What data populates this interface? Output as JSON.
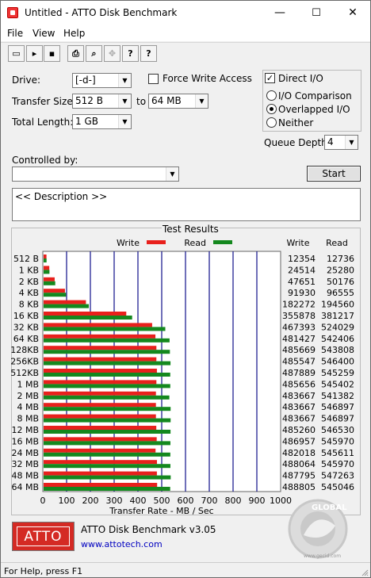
{
  "window": {
    "title": "Untitled - ATTO Disk Benchmark",
    "min": "—",
    "max": "☐",
    "close": "✕"
  },
  "menu": [
    "File",
    "View",
    "Help"
  ],
  "toolbar": {
    "new": "▭",
    "open": "▸",
    "save": "▪",
    "print": "⎙",
    "preview": "⌕",
    "move": "✥",
    "help": "?",
    "context_help": "?"
  },
  "form": {
    "drive_label": "Drive:",
    "drive_value": "[-d-]",
    "transfer_size_label": "Transfer Size:",
    "transfer_size_from": "512 B",
    "to_label": "to",
    "transfer_size_to": "64 MB",
    "total_length_label": "Total Length:",
    "total_length_value": "1 GB",
    "force_write_label": "Force Write Access",
    "force_write_checked": false,
    "direct_io_label": "Direct I/O",
    "direct_io_checked": true,
    "io_comparison_label": "I/O Comparison",
    "overlapped_io_label": "Overlapped I/O",
    "neither_label": "Neither",
    "selected_io_mode": "Overlapped I/O",
    "queue_depth_label": "Queue Depth:",
    "queue_depth_value": "4",
    "controlled_by_label": "Controlled by:",
    "controlled_by_value": "",
    "start_label": "Start",
    "description": "<< Description >>",
    "check_mark": "✓",
    "dropdown_arrow": "▼"
  },
  "results": {
    "title": "Test Results",
    "legend_write": "Write",
    "legend_read": "Read",
    "col_write": "Write",
    "col_read": "Read",
    "rows": [
      {
        "size": "512 B",
        "write": "12354",
        "read": "12736"
      },
      {
        "size": "1 KB",
        "write": "24514",
        "read": "25280"
      },
      {
        "size": "2 KB",
        "write": "47651",
        "read": "50176"
      },
      {
        "size": "4 KB",
        "write": "91930",
        "read": "96555"
      },
      {
        "size": "8 KB",
        "write": "182272",
        "read": "194560"
      },
      {
        "size": "16 KB",
        "write": "355878",
        "read": "381217"
      },
      {
        "size": "32 KB",
        "write": "467393",
        "read": "524029"
      },
      {
        "size": "64 KB",
        "write": "481427",
        "read": "542406"
      },
      {
        "size": "128KB",
        "write": "485669",
        "read": "543808"
      },
      {
        "size": "256KB",
        "write": "485547",
        "read": "546400"
      },
      {
        "size": "512KB",
        "write": "487889",
        "read": "545259"
      },
      {
        "size": "1 MB",
        "write": "485656",
        "read": "545402"
      },
      {
        "size": "2 MB",
        "write": "483667",
        "read": "541382"
      },
      {
        "size": "4 MB",
        "write": "483667",
        "read": "546897"
      },
      {
        "size": "8 MB",
        "write": "483667",
        "read": "546897"
      },
      {
        "size": "12 MB",
        "write": "485260",
        "read": "546530"
      },
      {
        "size": "16 MB",
        "write": "486957",
        "read": "545970"
      },
      {
        "size": "24 MB",
        "write": "482018",
        "read": "545611"
      },
      {
        "size": "32 MB",
        "write": "488064",
        "read": "545970"
      },
      {
        "size": "48 MB",
        "write": "487795",
        "read": "547263"
      },
      {
        "size": "64 MB",
        "write": "488805",
        "read": "545046"
      }
    ],
    "x_ticks": [
      "0",
      "100",
      "200",
      "300",
      "400",
      "500",
      "600",
      "700",
      "800",
      "900",
      "1000"
    ],
    "x_axis_label": "Transfer Rate - MB / Sec"
  },
  "chart_data": {
    "type": "bar",
    "orientation": "horizontal",
    "categories": [
      "512 B",
      "1 KB",
      "2 KB",
      "4 KB",
      "8 KB",
      "16 KB",
      "32 KB",
      "64 KB",
      "128KB",
      "256KB",
      "512KB",
      "1 MB",
      "2 MB",
      "4 MB",
      "8 MB",
      "12 MB",
      "16 MB",
      "24 MB",
      "32 MB",
      "48 MB",
      "64 MB"
    ],
    "series": [
      {
        "name": "Write",
        "color": "#e8201c",
        "values": [
          12354,
          24514,
          47651,
          91930,
          182272,
          355878,
          467393,
          481427,
          485669,
          485547,
          487889,
          485656,
          483667,
          483667,
          483667,
          485260,
          486957,
          482018,
          488064,
          487795,
          488805
        ]
      },
      {
        "name": "Read",
        "color": "#14881e",
        "values": [
          12736,
          25280,
          50176,
          96555,
          194560,
          381217,
          524029,
          542406,
          543808,
          546400,
          545259,
          545402,
          541382,
          546897,
          546897,
          546530,
          545970,
          545611,
          545970,
          547263,
          545046
        ]
      }
    ],
    "xlabel": "Transfer Rate - MB / Sec",
    "xlim": [
      0,
      1000
    ],
    "grid": true,
    "legend": "top"
  },
  "footer": {
    "logo": "ATTO",
    "version": "ATTO Disk Benchmark v3.05",
    "url": "www.attotech.com",
    "watermark": "GLOBAL",
    "watermark_url": "www.gecid.com"
  },
  "status": "For Help, press F1",
  "colors": {
    "write": "#e8201c",
    "read": "#14881e",
    "grid": "#0f0f8a"
  }
}
